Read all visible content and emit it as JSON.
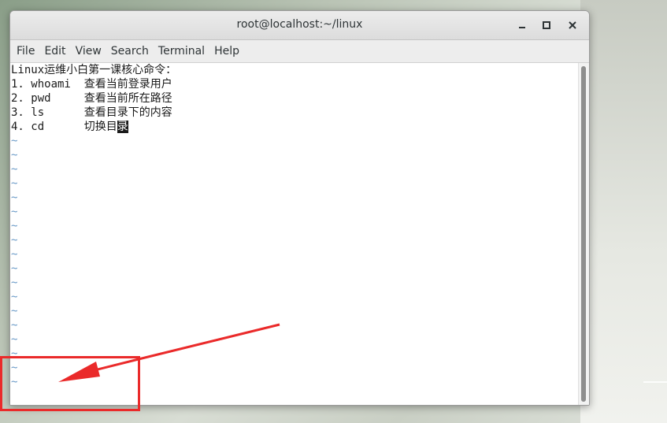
{
  "window": {
    "title": "root@localhost:~/linux",
    "controls": {
      "minimize_icon": "minimize-icon",
      "maximize_icon": "maximize-icon",
      "close_icon": "close-icon"
    }
  },
  "menubar": {
    "items": [
      "File",
      "Edit",
      "View",
      "Search",
      "Terminal",
      "Help"
    ]
  },
  "terminal": {
    "lines": [
      "Linux运维小白第一课核心命令：",
      "1. whoami  查看当前登录用户",
      "2. pwd     查看当前所在路径",
      "3. ls      查看目录下的内容"
    ],
    "last_line_prefix": "4. cd      切换目",
    "cursor_char": "录",
    "tilde": "~",
    "tilde_count": 18
  },
  "colors": {
    "tilde": "#6b9bc8",
    "annotation": "#ea2a2a"
  }
}
